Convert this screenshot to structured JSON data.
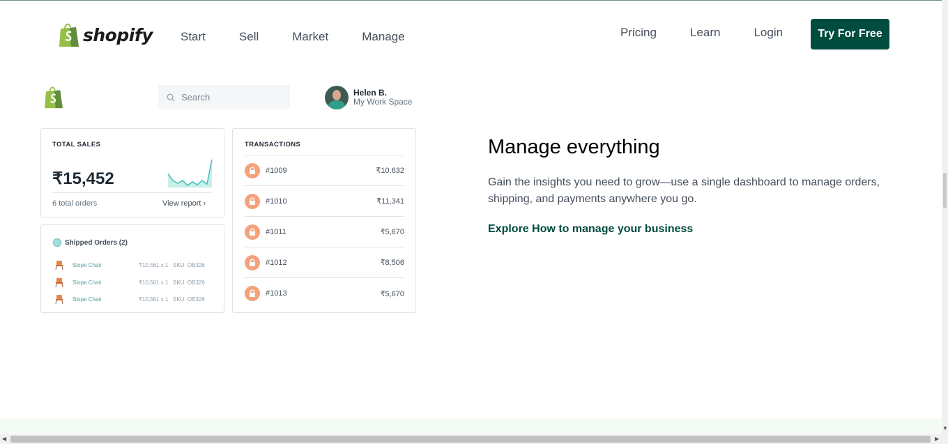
{
  "header": {
    "logo_text": "shopify",
    "nav_left": [
      "Start",
      "Sell",
      "Market",
      "Manage"
    ],
    "nav_right": {
      "pricing": "Pricing",
      "learn": "Learn",
      "login": "Login"
    },
    "cta_label": "Try For Free"
  },
  "dashboard": {
    "search_placeholder": "Search",
    "user": {
      "name": "Helen B.",
      "workspace": "My Work Space"
    },
    "total_sales": {
      "title": "TOTAL SALES",
      "value": "₹15,452",
      "orders": "6 total orders",
      "view_report": "View report"
    },
    "shipped": {
      "title": "Shipped Orders (2)",
      "items": [
        {
          "name": "Slope Chair",
          "qty": "₹10,561 x 1",
          "sku": "SKU: OB326"
        },
        {
          "name": "Slope Chair",
          "qty": "₹10,561 x 1",
          "sku": "SKU: OB326"
        },
        {
          "name": "Slope Chair",
          "qty": "₹10,561 x 1",
          "sku": "SKU: OB326"
        }
      ]
    },
    "transactions": {
      "title": "TRANSACTIONS",
      "rows": [
        {
          "id": "#1009",
          "amount": "₹10,632"
        },
        {
          "id": "#1010",
          "amount": "₹11,341"
        },
        {
          "id": "#1011",
          "amount": "₹5,670"
        },
        {
          "id": "#1012",
          "amount": "₹8,506"
        },
        {
          "id": "#1013",
          "amount": "₹5,670"
        }
      ]
    }
  },
  "content": {
    "headline": "Manage everything",
    "description": "Gain the insights you need to grow—use a single dashboard to manage orders, shipping, and payments anywhere you go.",
    "link": "Explore How to manage your business"
  },
  "colors": {
    "brand_green": "#004c3f",
    "logo_green": "#95bf47",
    "lock_orange": "#f4a27c",
    "spark_teal": "#47c1bf"
  }
}
